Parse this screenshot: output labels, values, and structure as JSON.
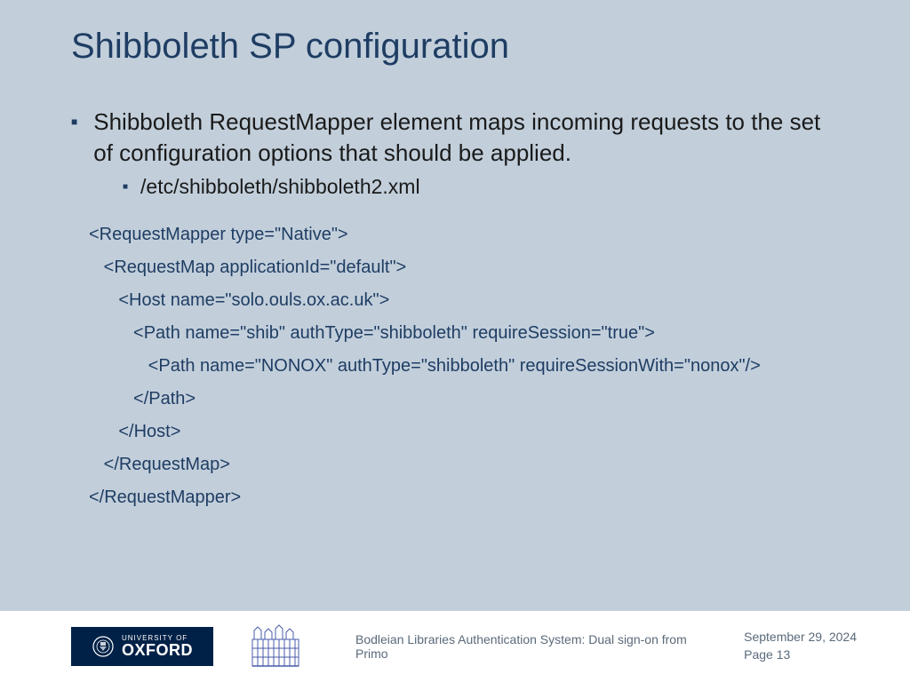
{
  "title": "Shibboleth SP configuration",
  "bullet": {
    "text": "Shibboleth RequestMapper element maps incoming requests to the set of configuration options that should be applied.",
    "sub": "/etc/shibboleth/shibboleth2.xml"
  },
  "code": {
    "l0": "<RequestMapper type=\"Native\">",
    "l1": "   <RequestMap applicationId=\"default\">",
    "l2": "      <Host name=\"solo.ouls.ox.ac.uk\">",
    "l3": "         <Path name=\"shib\" authType=\"shibboleth\" requireSession=\"true\">",
    "l4": "            <Path name=\"NONOX\" authType=\"shibboleth\" requireSessionWith=\"nonox\"/>",
    "l5": "         </Path>",
    "l6": "      </Host>",
    "l7": "   </RequestMap>",
    "l8": "</RequestMapper>"
  },
  "footer": {
    "oxford_uni": "UNIVERSITY OF",
    "oxford_name": "OXFORD",
    "presentation_title": "Bodleian Libraries Authentication System: Dual sign-on from Primo",
    "date": "September 29, 2024",
    "page": "Page 13"
  }
}
